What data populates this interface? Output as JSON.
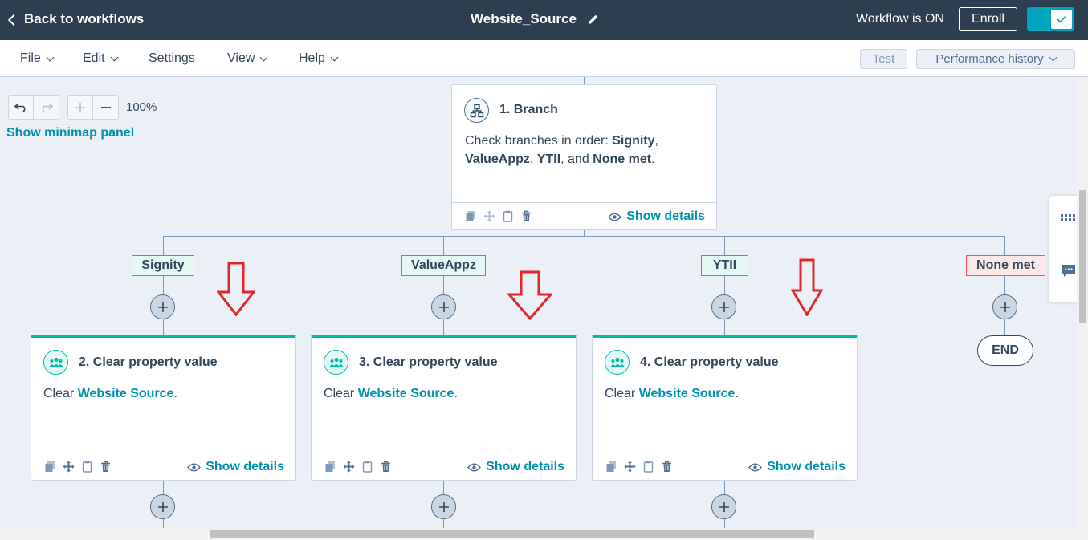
{
  "header": {
    "back_label": "Back to workflows",
    "title": "Website_Source",
    "status": "Workflow is ON",
    "enroll_label": "Enroll"
  },
  "menu": {
    "items": [
      "File",
      "Edit",
      "Settings",
      "View",
      "Help"
    ],
    "test_label": "Test",
    "performance_label": "Performance history"
  },
  "canvas": {
    "zoom": "100%",
    "minimap_label": "Show minimap panel"
  },
  "branch_card": {
    "title": "1. Branch",
    "text_prefix": "Check branches in order: ",
    "b1": "Signity",
    "sep1": ",",
    "b2": "ValueAppz",
    "sep2": ", ",
    "b3": "YTII",
    "sep3": ", and ",
    "b4": "None met",
    "end": ".",
    "details_label": "Show details"
  },
  "branches": [
    {
      "label": "Signity"
    },
    {
      "label": "ValueAppz"
    },
    {
      "label": "YTII"
    },
    {
      "label": "None met"
    }
  ],
  "actions": [
    {
      "title": "2. Clear property value",
      "prefix": "Clear ",
      "property": "Website Source",
      "suffix": ".",
      "details_label": "Show details"
    },
    {
      "title": "3. Clear property value",
      "prefix": "Clear ",
      "property": "Website Source",
      "suffix": ".",
      "details_label": "Show details"
    },
    {
      "title": "4. Clear property value",
      "prefix": "Clear ",
      "property": "Website Source",
      "suffix": ".",
      "details_label": "Show details"
    }
  ],
  "end_label": "END",
  "colors": {
    "header_bg": "#2d3e50",
    "accent": "#00a4bd",
    "link": "#0091ae",
    "action_bar": "#00bda5",
    "annotation_arrow": "#e3262e"
  }
}
